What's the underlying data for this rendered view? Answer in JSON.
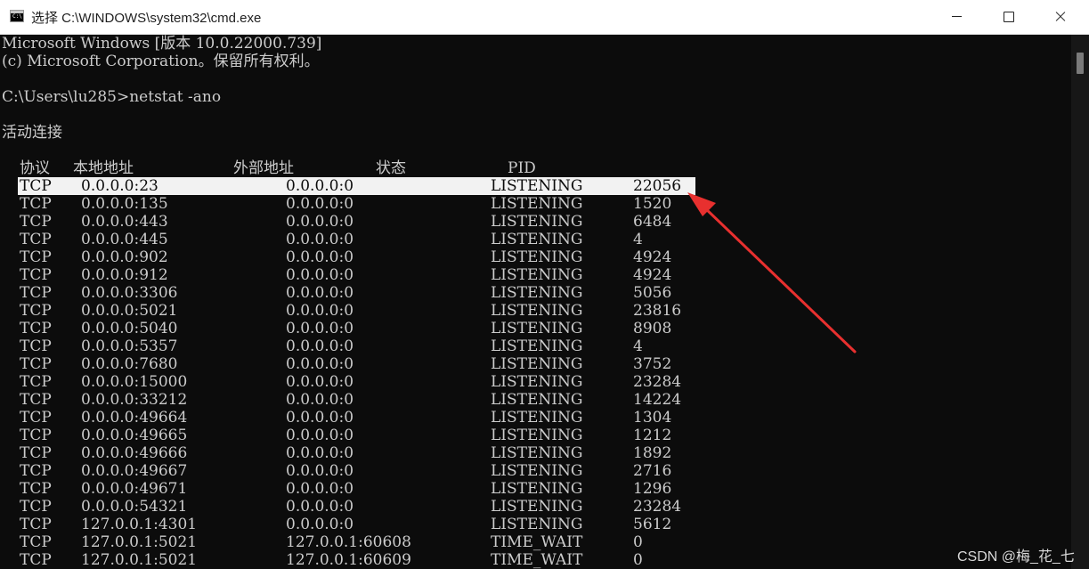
{
  "window": {
    "title": "选择 C:\\WINDOWS\\system32\\cmd.exe",
    "icon": "cmd-icon"
  },
  "console": {
    "lines": [
      "Microsoft Windows [版本 10.0.22000.739]",
      "(c) Microsoft Corporation。保留所有权利。",
      "",
      "C:\\Users\\lu285>netstat -ano",
      "",
      "活动连接"
    ],
    "headers": [
      "协议",
      "本地地址",
      "外部地址",
      "状态",
      "PID"
    ],
    "rows": [
      [
        "TCP",
        "0.0.0.0:23",
        "0.0.0.0:0",
        "LISTENING",
        "22056"
      ],
      [
        "TCP",
        "0.0.0.0:135",
        "0.0.0.0:0",
        "LISTENING",
        "1520"
      ],
      [
        "TCP",
        "0.0.0.0:443",
        "0.0.0.0:0",
        "LISTENING",
        "6484"
      ],
      [
        "TCP",
        "0.0.0.0:445",
        "0.0.0.0:0",
        "LISTENING",
        "4"
      ],
      [
        "TCP",
        "0.0.0.0:902",
        "0.0.0.0:0",
        "LISTENING",
        "4924"
      ],
      [
        "TCP",
        "0.0.0.0:912",
        "0.0.0.0:0",
        "LISTENING",
        "4924"
      ],
      [
        "TCP",
        "0.0.0.0:3306",
        "0.0.0.0:0",
        "LISTENING",
        "5056"
      ],
      [
        "TCP",
        "0.0.0.0:5021",
        "0.0.0.0:0",
        "LISTENING",
        "23816"
      ],
      [
        "TCP",
        "0.0.0.0:5040",
        "0.0.0.0:0",
        "LISTENING",
        "8908"
      ],
      [
        "TCP",
        "0.0.0.0:5357",
        "0.0.0.0:0",
        "LISTENING",
        "4"
      ],
      [
        "TCP",
        "0.0.0.0:7680",
        "0.0.0.0:0",
        "LISTENING",
        "3752"
      ],
      [
        "TCP",
        "0.0.0.0:15000",
        "0.0.0.0:0",
        "LISTENING",
        "23284"
      ],
      [
        "TCP",
        "0.0.0.0:33212",
        "0.0.0.0:0",
        "LISTENING",
        "14224"
      ],
      [
        "TCP",
        "0.0.0.0:49664",
        "0.0.0.0:0",
        "LISTENING",
        "1304"
      ],
      [
        "TCP",
        "0.0.0.0:49665",
        "0.0.0.0:0",
        "LISTENING",
        "1212"
      ],
      [
        "TCP",
        "0.0.0.0:49666",
        "0.0.0.0:0",
        "LISTENING",
        "1892"
      ],
      [
        "TCP",
        "0.0.0.0:49667",
        "0.0.0.0:0",
        "LISTENING",
        "2716"
      ],
      [
        "TCP",
        "0.0.0.0:49671",
        "0.0.0.0:0",
        "LISTENING",
        "1296"
      ],
      [
        "TCP",
        "0.0.0.0:54321",
        "0.0.0.0:0",
        "LISTENING",
        "23284"
      ],
      [
        "TCP",
        "127.0.0.1:4301",
        "0.0.0.0:0",
        "LISTENING",
        "5612"
      ],
      [
        "TCP",
        "127.0.0.1:5021",
        "127.0.0.1:60608",
        "TIME_WAIT",
        "0"
      ],
      [
        "TCP",
        "127.0.0.1:5021",
        "127.0.0.1:60609",
        "TIME_WAIT",
        "0"
      ]
    ],
    "selected_row": 0,
    "colors": {
      "background": "#0c0c0c",
      "text": "#cccccc",
      "selection": "#f2f2f2",
      "arrow": "#e8302f"
    }
  },
  "watermark": "CSDN @梅_花_七"
}
